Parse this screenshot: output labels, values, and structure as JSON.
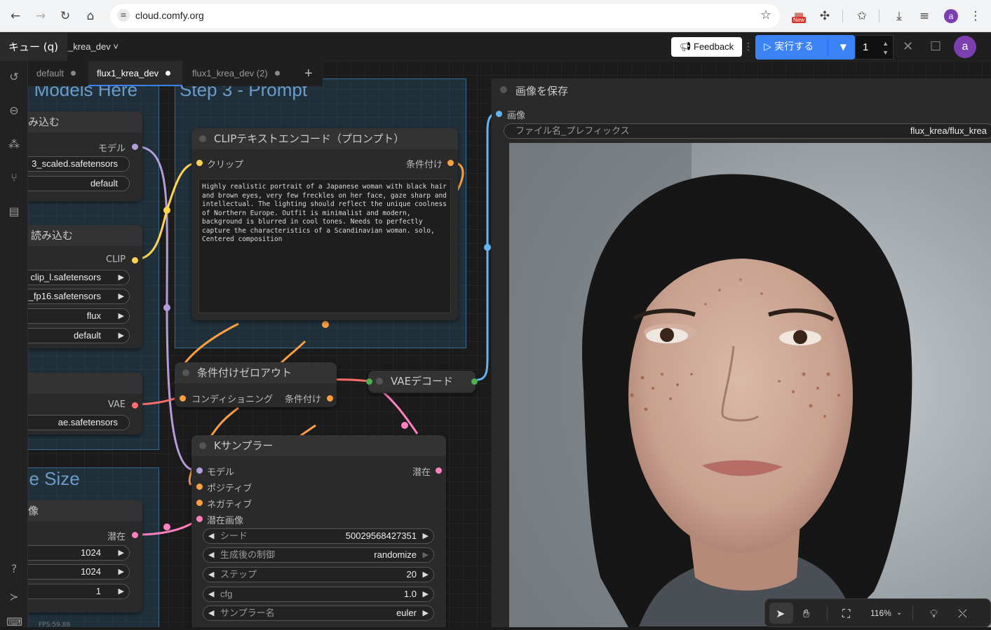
{
  "browser": {
    "url": "cloud.comfy.org",
    "new_badge": "New",
    "avatar_letter": "a"
  },
  "topbar": {
    "queue_label": "キュー (q)",
    "workflow_name": "_krea_dev ˅",
    "feedback_label": "Feedback",
    "run_label": "実行する",
    "batch_count": "1",
    "avatar_letter": "a"
  },
  "tabs": [
    {
      "label": "default"
    },
    {
      "label": "flux1_krea_dev"
    },
    {
      "label": "flux1_krea_dev (2)"
    }
  ],
  "groups": {
    "models": "d Models Here",
    "prompt": "Step 3 - Prompt",
    "image_size": "ge Size"
  },
  "nodes": {
    "unet": {
      "title": "み込む",
      "out_model": "モデル",
      "unet_name": "3_scaled.safetensors",
      "weight_dtype": "default"
    },
    "dualclip": {
      "title": "読み込む",
      "out_clip": "CLIP",
      "clip1": "clip_l.safetensors",
      "clip2": "_fp16.safetensors",
      "type": "flux",
      "device": "default"
    },
    "vae_loader": {
      "out_vae": "VAE",
      "vae_name": "ae.safetensors"
    },
    "latent": {
      "title": "像",
      "out_latent": "潜在",
      "width": "1024",
      "height": "1024",
      "batch": "1"
    },
    "clip_encode": {
      "title": "CLIPテキストエンコード（プロンプト）",
      "in_clip": "クリップ",
      "out_cond": "条件付け",
      "text": "Highly realistic portrait of a Japanese woman with black hair and brown eyes, very few freckles on her face, gaze sharp and intellectual. The lighting should reflect the unique coolness of Northern Europe. Outfit is minimalist and modern, background is blurred in cool tones. Needs to perfectly capture the characteristics of a Scandinavian woman. solo, Centered composition"
    },
    "zero_out": {
      "title": "条件付けゼロアウト",
      "in_cond": "コンディショニング",
      "out_cond": "条件付け"
    },
    "vae_decode": {
      "title": "VAEデコード"
    },
    "ksampler": {
      "title": "Kサンプラー",
      "in_model": "モデル",
      "in_positive": "ポジティブ",
      "in_negative": "ネガティブ",
      "in_latent": "潜在画像",
      "out_latent": "潜在",
      "widgets": [
        {
          "label": "シード",
          "value": "50029568427351"
        },
        {
          "label": "生成後の制御",
          "value": "randomize"
        },
        {
          "label": "ステップ",
          "value": "20"
        },
        {
          "label": "cfg",
          "value": "1.0"
        },
        {
          "label": "サンプラー名",
          "value": "euler"
        }
      ]
    },
    "save_image": {
      "title": "画像を保存",
      "in_image": "画像",
      "prefix_label": "ファイル名_プレフィックス",
      "prefix_value": "flux_krea/flux_krea"
    }
  },
  "canvas_toolbar": {
    "zoom": "116%"
  },
  "status": {
    "fps": "FPS:59.88"
  },
  "colors": {
    "model": "#b39ddb",
    "clip": "#ffd54f",
    "conditioning": "#ffa040",
    "vae": "#ff6e6e",
    "latent": "#ff80c0",
    "image": "#64b5f6",
    "run": "#3b82f6"
  }
}
